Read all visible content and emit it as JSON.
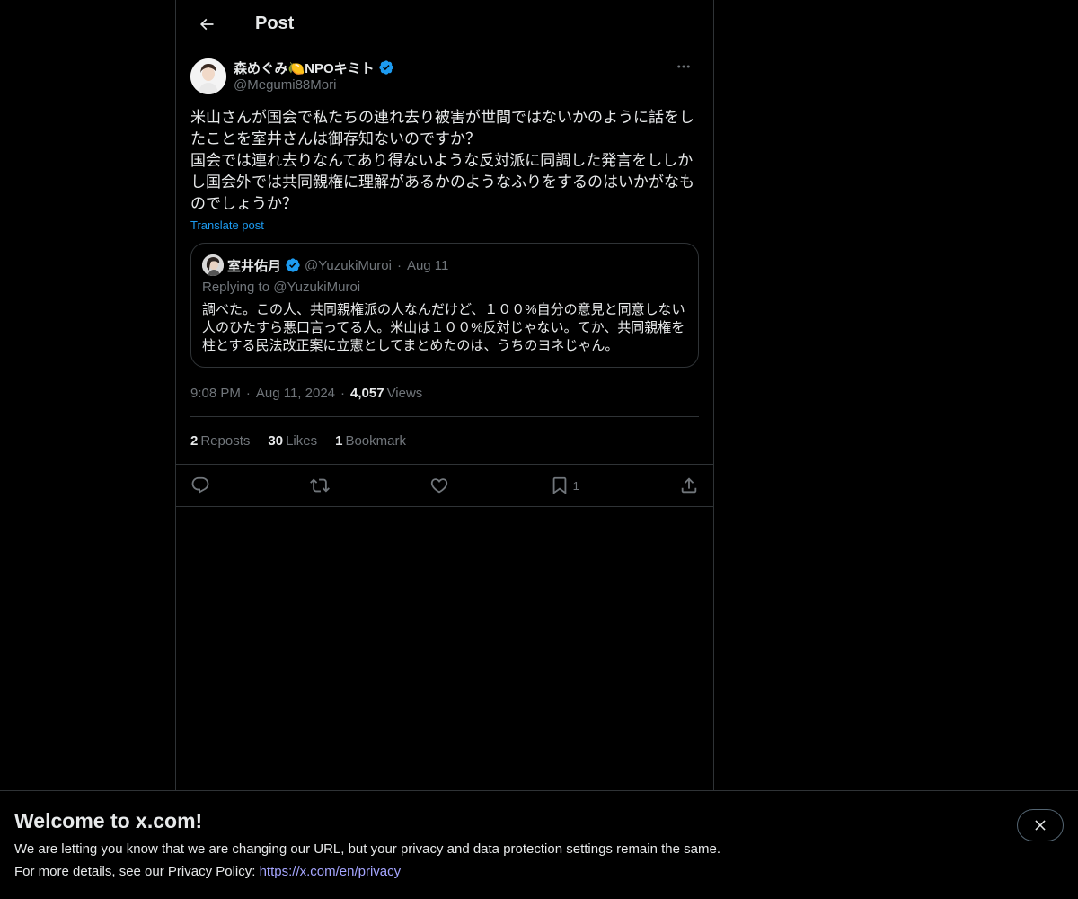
{
  "header": {
    "title": "Post"
  },
  "post": {
    "author_name": "森めぐみ🍋NPOキミト",
    "author_handle": "@Megumi88Mori",
    "text": "米山さんが国会で私たちの連れ去り被害が世間ではないかのように話をしたことを室井さんは御存知ないのですか？\n国会では連れ去りなんてあり得ないような反対派に同調した発言をししかし国会外では共同親権に理解があるかのようなふりをするのはいかがなものでしょうか？",
    "translate_label": "Translate post",
    "time": "9:08 PM",
    "date": "Aug 11, 2024",
    "views_count": "4,057",
    "views_label": "Views"
  },
  "quote": {
    "name": "室井佑月",
    "handle": "@YuzukiMuroi",
    "date": "Aug 11",
    "replying": "Replying to @YuzukiMuroi",
    "text": "調べた。この人、共同親権派の人なんだけど、１００%自分の意見と同意しない人のひたすら悪口言ってる人。米山は１００%反対じゃない。てか、共同親権を柱とする民法改正案に立憲としてまとめたのは、うちのヨネじゃん。"
  },
  "stats": {
    "reposts_count": "2",
    "reposts_label": "Reposts",
    "likes_count": "30",
    "likes_label": "Likes",
    "bookmarks_count": "1",
    "bookmarks_label": "Bookmark"
  },
  "actions": {
    "bookmark_count": "1"
  },
  "banner": {
    "title": "Welcome to x.com!",
    "line1": "We are letting you know that we are changing our URL, but your privacy and data protection settings remain the same.",
    "line2_prefix": "For more details, see our Privacy Policy: ",
    "link": "https://x.com/en/privacy"
  },
  "colors": {
    "accent": "#1d9bf0",
    "muted": "#71767b",
    "border": "#2f3336",
    "link": "#a5a5ff"
  }
}
